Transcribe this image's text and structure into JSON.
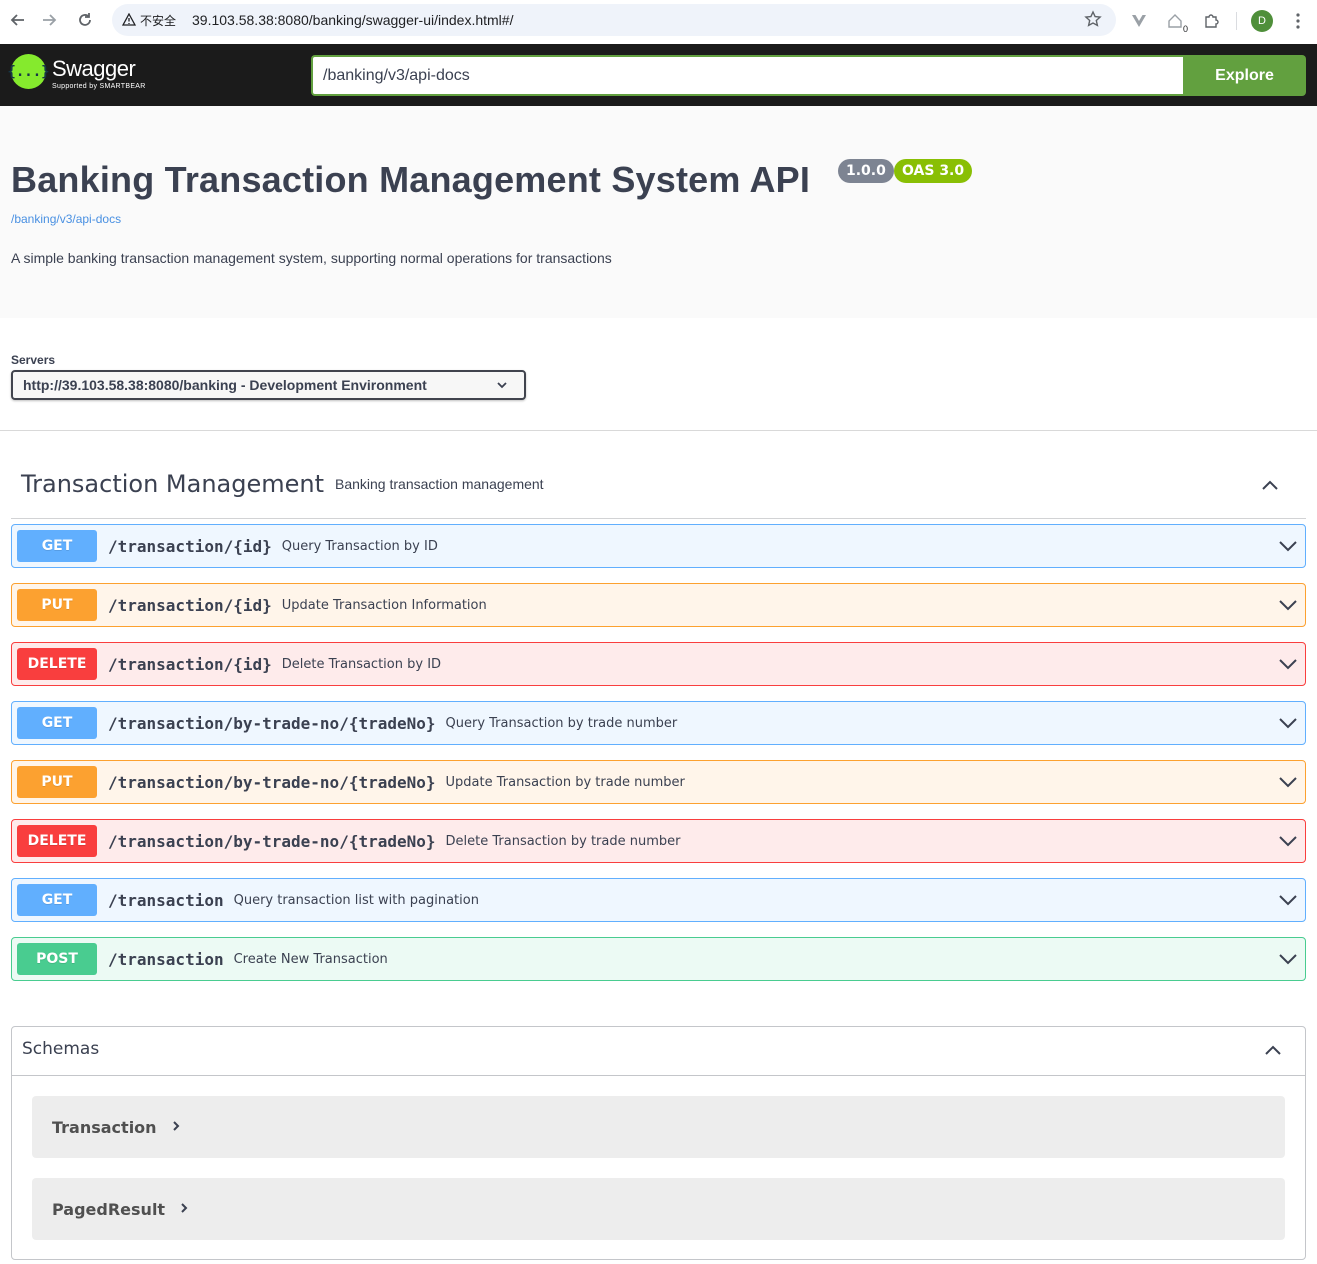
{
  "browser": {
    "security_label": "不安全",
    "url": "39.103.58.38:8080/banking/swagger-ui/index.html#/",
    "avatar_initial": "D",
    "ext_badge": "0"
  },
  "topbar": {
    "logo_text": "Swagger",
    "logo_sub": "Supported by SMARTBEAR",
    "logo_mark": "{...}",
    "explore_value": "/banking/v3/api-docs",
    "explore_label": "Explore"
  },
  "info": {
    "title": "Banking Transaction Management System API",
    "version": "1.0.0",
    "oas": "OAS 3.0",
    "spec_link": "/banking/v3/api-docs",
    "description": "A simple banking transaction management system, supporting normal operations for transactions"
  },
  "servers": {
    "label": "Servers",
    "selected": "http://39.103.58.38:8080/banking - Development Environment"
  },
  "tag": {
    "name": "Transaction Management",
    "description": "Banking transaction management"
  },
  "operations": [
    {
      "method": "GET",
      "path": "/transaction/{id}",
      "summary": "Query Transaction by ID"
    },
    {
      "method": "PUT",
      "path": "/transaction/{id}",
      "summary": "Update Transaction Information"
    },
    {
      "method": "DELETE",
      "path": "/transaction/{id}",
      "summary": "Delete Transaction by ID"
    },
    {
      "method": "GET",
      "path": "/transaction/by-trade-no/{tradeNo}",
      "summary": "Query Transaction by trade number"
    },
    {
      "method": "PUT",
      "path": "/transaction/by-trade-no/{tradeNo}",
      "summary": "Update Transaction by trade number"
    },
    {
      "method": "DELETE",
      "path": "/transaction/by-trade-no/{tradeNo}",
      "summary": "Delete Transaction by trade number"
    },
    {
      "method": "GET",
      "path": "/transaction",
      "summary": "Query transaction list with pagination"
    },
    {
      "method": "POST",
      "path": "/transaction",
      "summary": "Create New Transaction"
    }
  ],
  "schemas": {
    "title": "Schemas",
    "models": [
      "Transaction",
      "PagedResult"
    ]
  },
  "colors": {
    "get": "#61affe",
    "put": "#fca130",
    "delete": "#f93e3e",
    "post": "#49cc90",
    "explore": "#62a03f",
    "topbar": "#1b1b1b"
  }
}
